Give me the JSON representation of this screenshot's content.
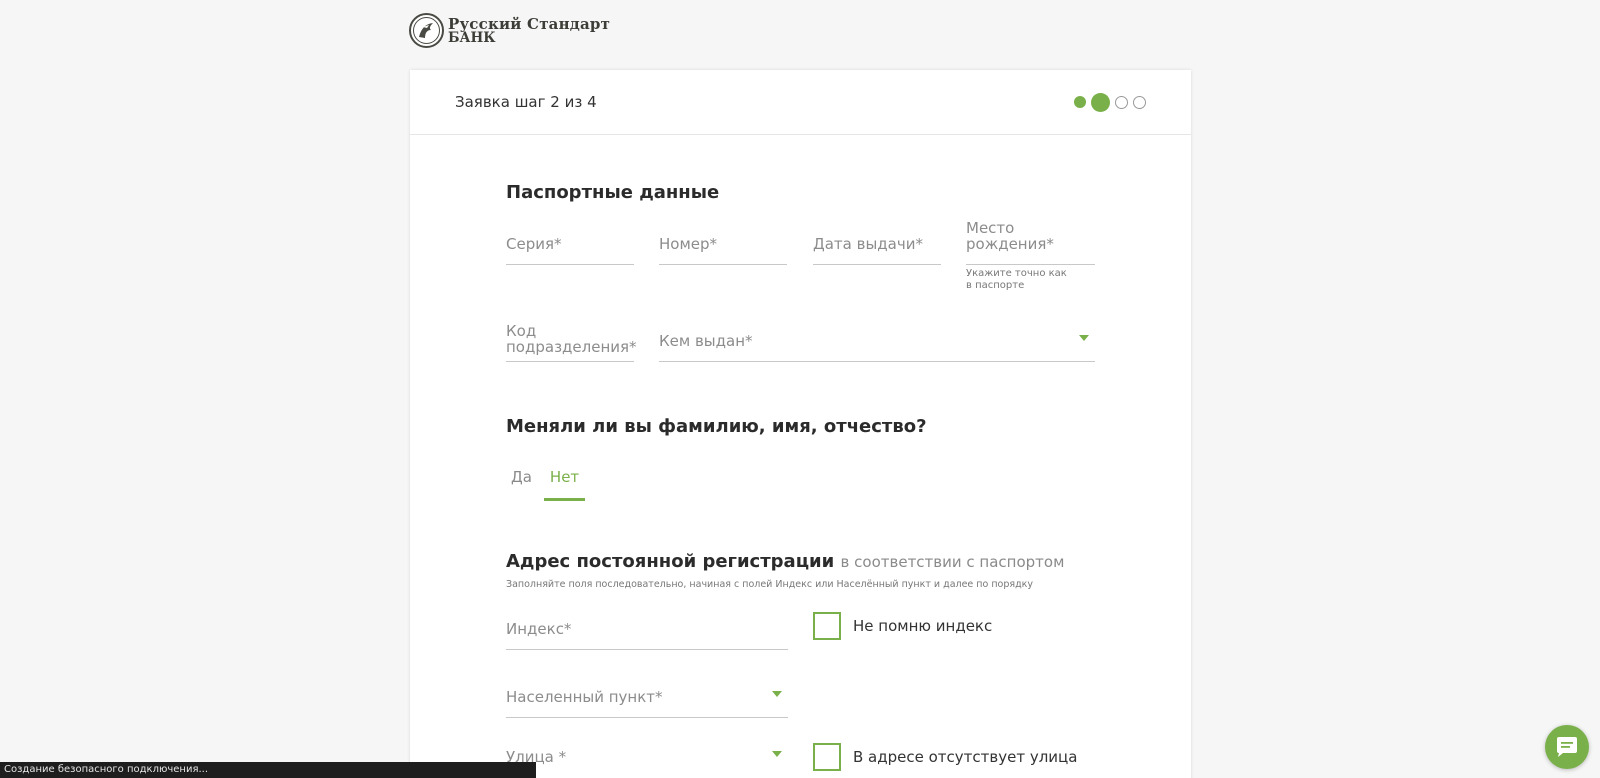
{
  "logo": {
    "line1": "Русский Стандарт",
    "line2": "БАНК"
  },
  "header": {
    "step_title": "Заявка шаг 2 из 4",
    "steps_total": 4,
    "current_step": 2
  },
  "passport": {
    "title": "Паспортные данные",
    "series_placeholder": "Серия*",
    "number_placeholder": "Номер*",
    "issue_date_placeholder": "Дата выдачи*",
    "birthplace_placeholder": "Место рождения*",
    "birthplace_hint_1": "Укажите точно как",
    "birthplace_hint_2": "в паспорте",
    "dept_code_line1": "Код",
    "dept_code_line2": "подразделения*",
    "issued_by_placeholder": "Кем выдан*"
  },
  "name_change": {
    "title": "Меняли ли вы фамилию, имя, отчество?",
    "option_yes": "Да",
    "option_no": "Нет",
    "selected": "Нет"
  },
  "address": {
    "title": "Адрес постоянной регистрации",
    "title_sub": "в соответствии с паспортом",
    "hint": "Заполняйте поля последовательно, начиная с полей Индекс или Населённый пункт и далее по порядку",
    "index_placeholder": "Индекс*",
    "forgot_index_label": "Не помню индекс",
    "locality_placeholder": "Населенный пункт*",
    "street_placeholder": "Улица *",
    "no_street_label": "В адресе отсутствует улица"
  },
  "status_bar": {
    "text": "Создание безопасного подключения..."
  },
  "colors": {
    "accent": "#7ab04a",
    "background": "#f5f6f5"
  },
  "icons": {
    "chat": "chat-bubble-icon",
    "dropdown": "chevron-down-icon",
    "logo": "bank-emblem-icon"
  }
}
